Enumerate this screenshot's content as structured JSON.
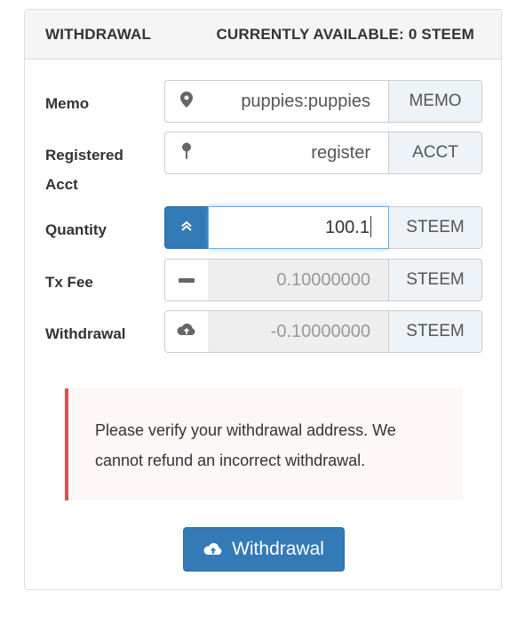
{
  "header": {
    "title": "WITHDRAWAL",
    "available": "CURRENTLY AVAILABLE: 0 STEEM"
  },
  "rows": {
    "memo": {
      "label": "Memo",
      "icon": "map-marker-icon",
      "value": "puppies:puppies",
      "addon": "MEMO"
    },
    "registered_acct": {
      "label_line1": "Registered",
      "label_line2": "Acct",
      "icon": "pushpin-icon",
      "value": "register",
      "addon": "ACCT"
    },
    "quantity": {
      "label": "Quantity",
      "icon": "chevron-double-up-icon",
      "value": "100.1",
      "addon": "STEEM"
    },
    "tx_fee": {
      "label": "Tx Fee",
      "icon": "minus-icon",
      "value": "0.10000000",
      "addon": "STEEM"
    },
    "withdrawal": {
      "label": "Withdrawal",
      "icon": "cloud-upload-icon",
      "value": "-0.10000000",
      "addon": "STEEM"
    }
  },
  "alert": {
    "line1": "Please verify your withdrawal address. We",
    "line2": "cannot refund an incorrect withdrawal."
  },
  "button": {
    "label": "Withdrawal",
    "icon": "cloud-upload-icon"
  },
  "colors": {
    "primary": "#337ab7",
    "danger_border": "#d9534f",
    "alert_bg": "#fdf7f7",
    "addon_bg": "#eef3f8",
    "disabled_bg": "#eeeeee"
  }
}
